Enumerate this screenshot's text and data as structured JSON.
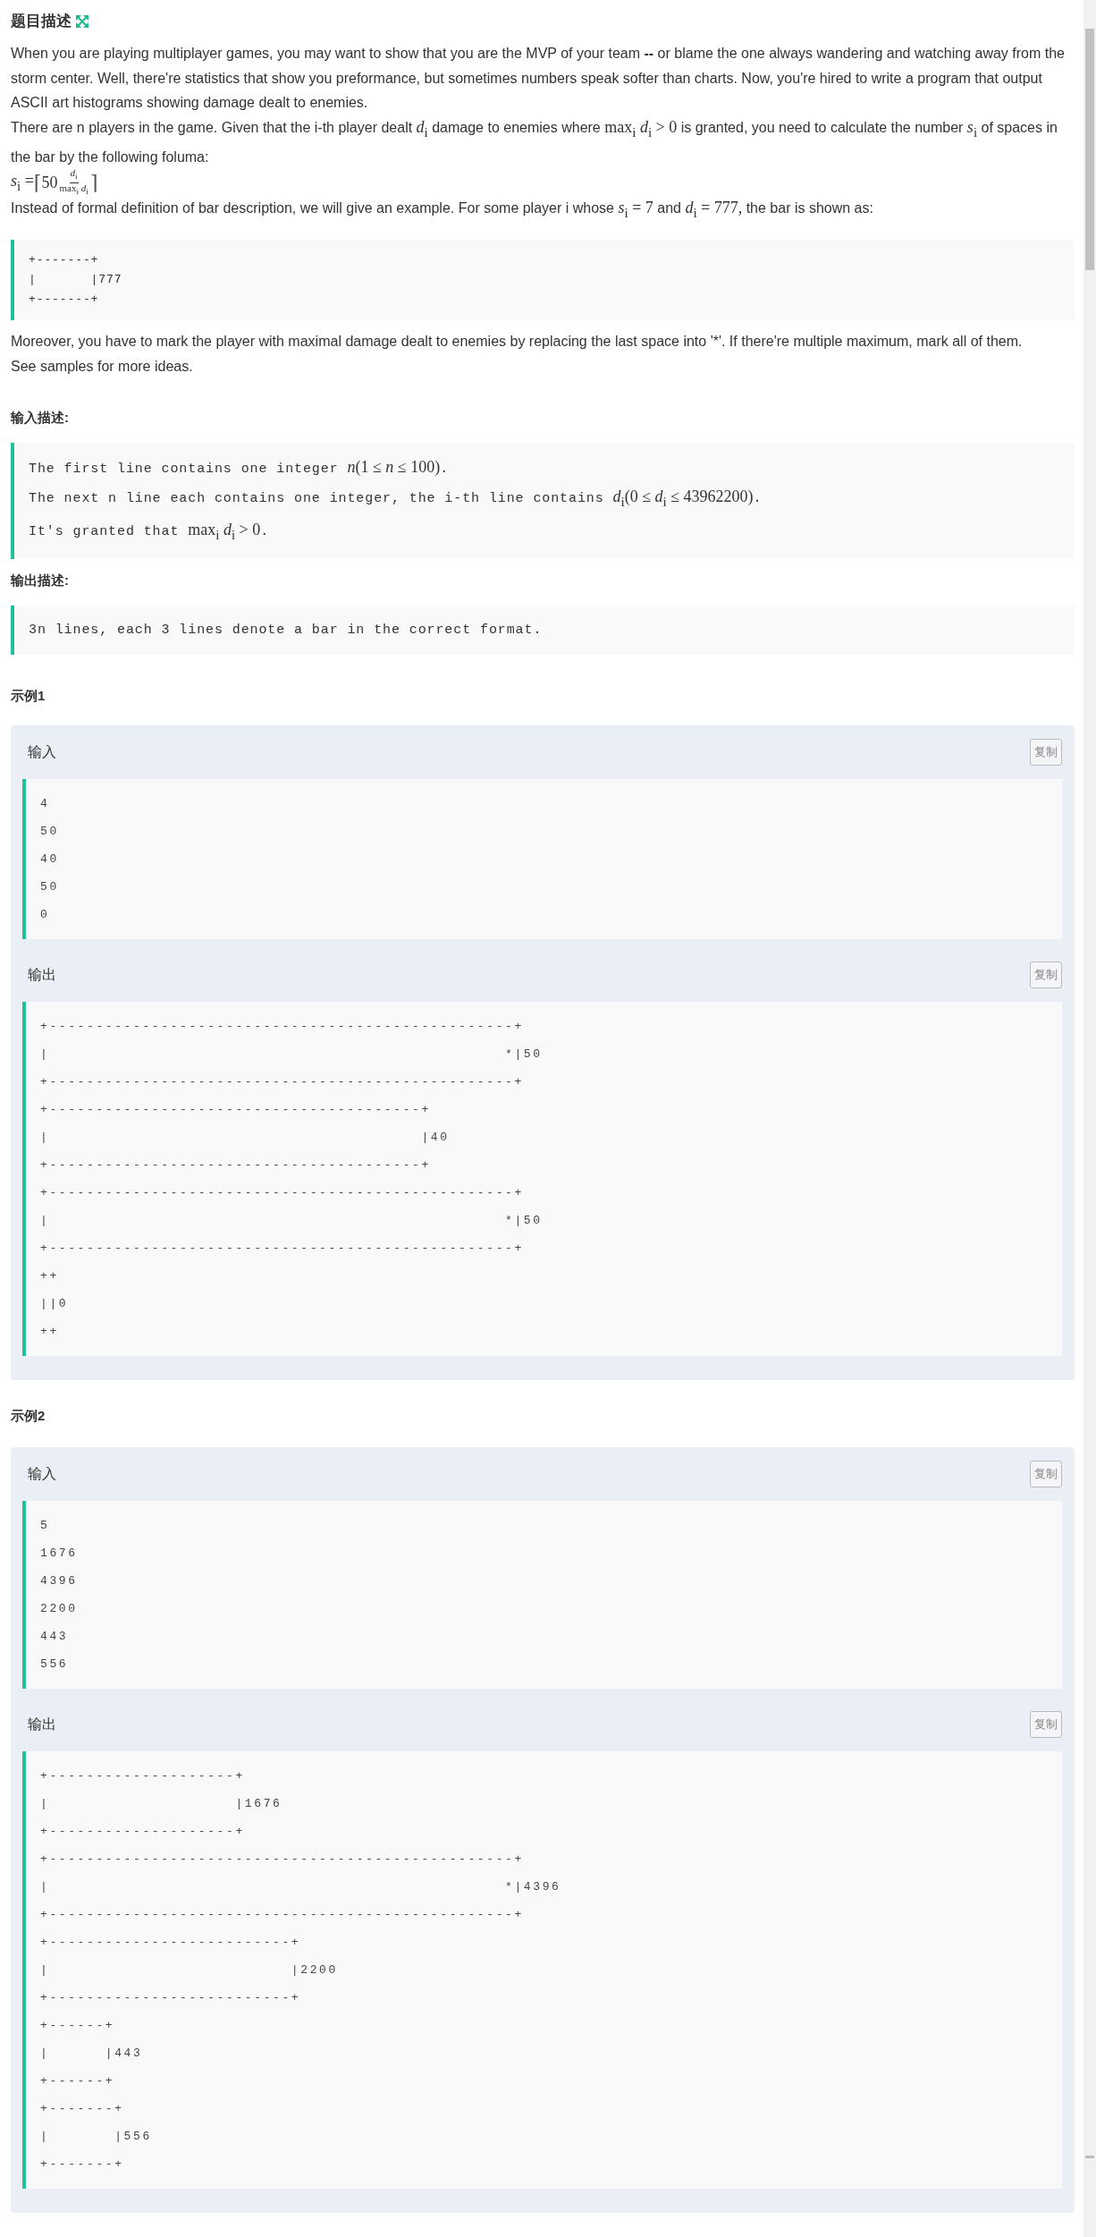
{
  "description": {
    "title": "题目描述",
    "blocks": [
      {
        "kind": "paragraph",
        "segments": [
          {
            "kind": "text",
            "text": "When you are playing multiplayer games, you may want to show that you are the MVP of your team **--** or blame the one always wandering and watching away from the storm center. Well, there're statistics that show you preformance, but sometimes numbers speak softer than charts. Now, you're hired to write a program that output ASCII art histograms showing damage dealt to enemies."
          }
        ]
      },
      {
        "kind": "paragraph",
        "segments": [
          {
            "kind": "text",
            "text": "There are n players in the game. Given that the i-th player dealt "
          },
          {
            "kind": "math",
            "text": "*d*$_{i}$"
          },
          {
            "kind": "text",
            "text": " damage to enemies where "
          },
          {
            "kind": "math",
            "text": "max$_{i}$ *d*$_{i}$ > 0"
          },
          {
            "kind": "text",
            "text": " is granted, you need to calculate the number "
          },
          {
            "kind": "math",
            "text": "*s*$_{i}$"
          },
          {
            "kind": "text",
            "text": " of spaces in the bar by the following foluma:"
          }
        ]
      },
      {
        "kind": "formula",
        "lhs": "*s*$_{i}$ = ",
        "open": "⌈",
        "coefficient": "50",
        "numerator": "*d*$_{i}$",
        "denominator": "max$_{i}$ *d*$_{i}$",
        "close": "⌉"
      },
      {
        "kind": "paragraph",
        "segments": [
          {
            "kind": "text",
            "text": "Instead of formal definition of bar description, we will give an example. For some player i whose "
          },
          {
            "kind": "math",
            "text": "*s*$_{i}$ = 7"
          },
          {
            "kind": "text",
            "text": " and "
          },
          {
            "kind": "math",
            "text": "*d*$_{i}$ = 777,"
          },
          {
            "kind": "text",
            "text": " the bar is shown as:"
          }
        ]
      },
      {
        "kind": "code",
        "lines": [
          "+-------+",
          "|       |777",
          "+-------+"
        ]
      },
      {
        "kind": "paragraph",
        "segments": [
          {
            "kind": "text",
            "text": "Moreover, you have to mark the player with maximal damage dealt to enemies by replacing the last space into '*'. If there're multiple maximum, mark all of them."
          }
        ]
      },
      {
        "kind": "paragraph",
        "segments": [
          {
            "kind": "text",
            "text": "See samples for more ideas."
          }
        ]
      }
    ]
  },
  "input_description": {
    "title": "输入描述:",
    "lines": [
      [
        {
          "kind": "text",
          "text": "The first line contains one integer "
        },
        {
          "kind": "math",
          "text": "*n*(1 ≤ *n* ≤ 100)"
        },
        {
          "kind": "text",
          "text": "."
        }
      ],
      [
        {
          "kind": "text",
          "text": "The next n line each contains one integer, the i-th line contains "
        },
        {
          "kind": "math",
          "text": "*d*$_{i}$(0 ≤ *d*$_{i}$ ≤ 43962200)"
        },
        {
          "kind": "text",
          "text": "."
        }
      ],
      [
        {
          "kind": "text",
          "text": "It's granted that "
        },
        {
          "kind": "math",
          "text": "max$_{i}$ *d*$_{i}$ > 0"
        },
        {
          "kind": "text",
          "text": "."
        }
      ]
    ]
  },
  "output_description": {
    "title": "输出描述:",
    "lines": [
      [
        {
          "kind": "text",
          "text": "3n lines, each 3 lines denote a bar in the correct format."
        }
      ]
    ]
  },
  "examples": [
    {
      "title": "示例1",
      "input": {
        "label": "输入",
        "copy_button": "复制",
        "lines": [
          "4",
          "50",
          "40",
          "50",
          "0"
        ]
      },
      "output": {
        "label": "输出",
        "copy_button": "复制",
        "lines": [
          "+--------------------------------------------------+",
          "|                                                 *|50",
          "+--------------------------------------------------+",
          "+----------------------------------------+",
          "|                                        |40",
          "+----------------------------------------+",
          "+--------------------------------------------------+",
          "|                                                 *|50",
          "+--------------------------------------------------+",
          "++",
          "||0",
          "++"
        ]
      }
    },
    {
      "title": "示例2",
      "input": {
        "label": "输入",
        "copy_button": "复制",
        "lines": [
          "5",
          "1676",
          "4396",
          "2200",
          "443",
          "556"
        ]
      },
      "output": {
        "label": "输出",
        "copy_button": "复制",
        "lines": [
          "+--------------------+",
          "|                    |1676",
          "+--------------------+",
          "+--------------------------------------------------+",
          "|                                                 *|4396",
          "+--------------------------------------------------+",
          "+--------------------------+",
          "|                          |2200",
          "+--------------------------+",
          "+------+",
          "|      |443",
          "+------+",
          "+-------+",
          "|       |556",
          "+-------+"
        ]
      }
    }
  ]
}
